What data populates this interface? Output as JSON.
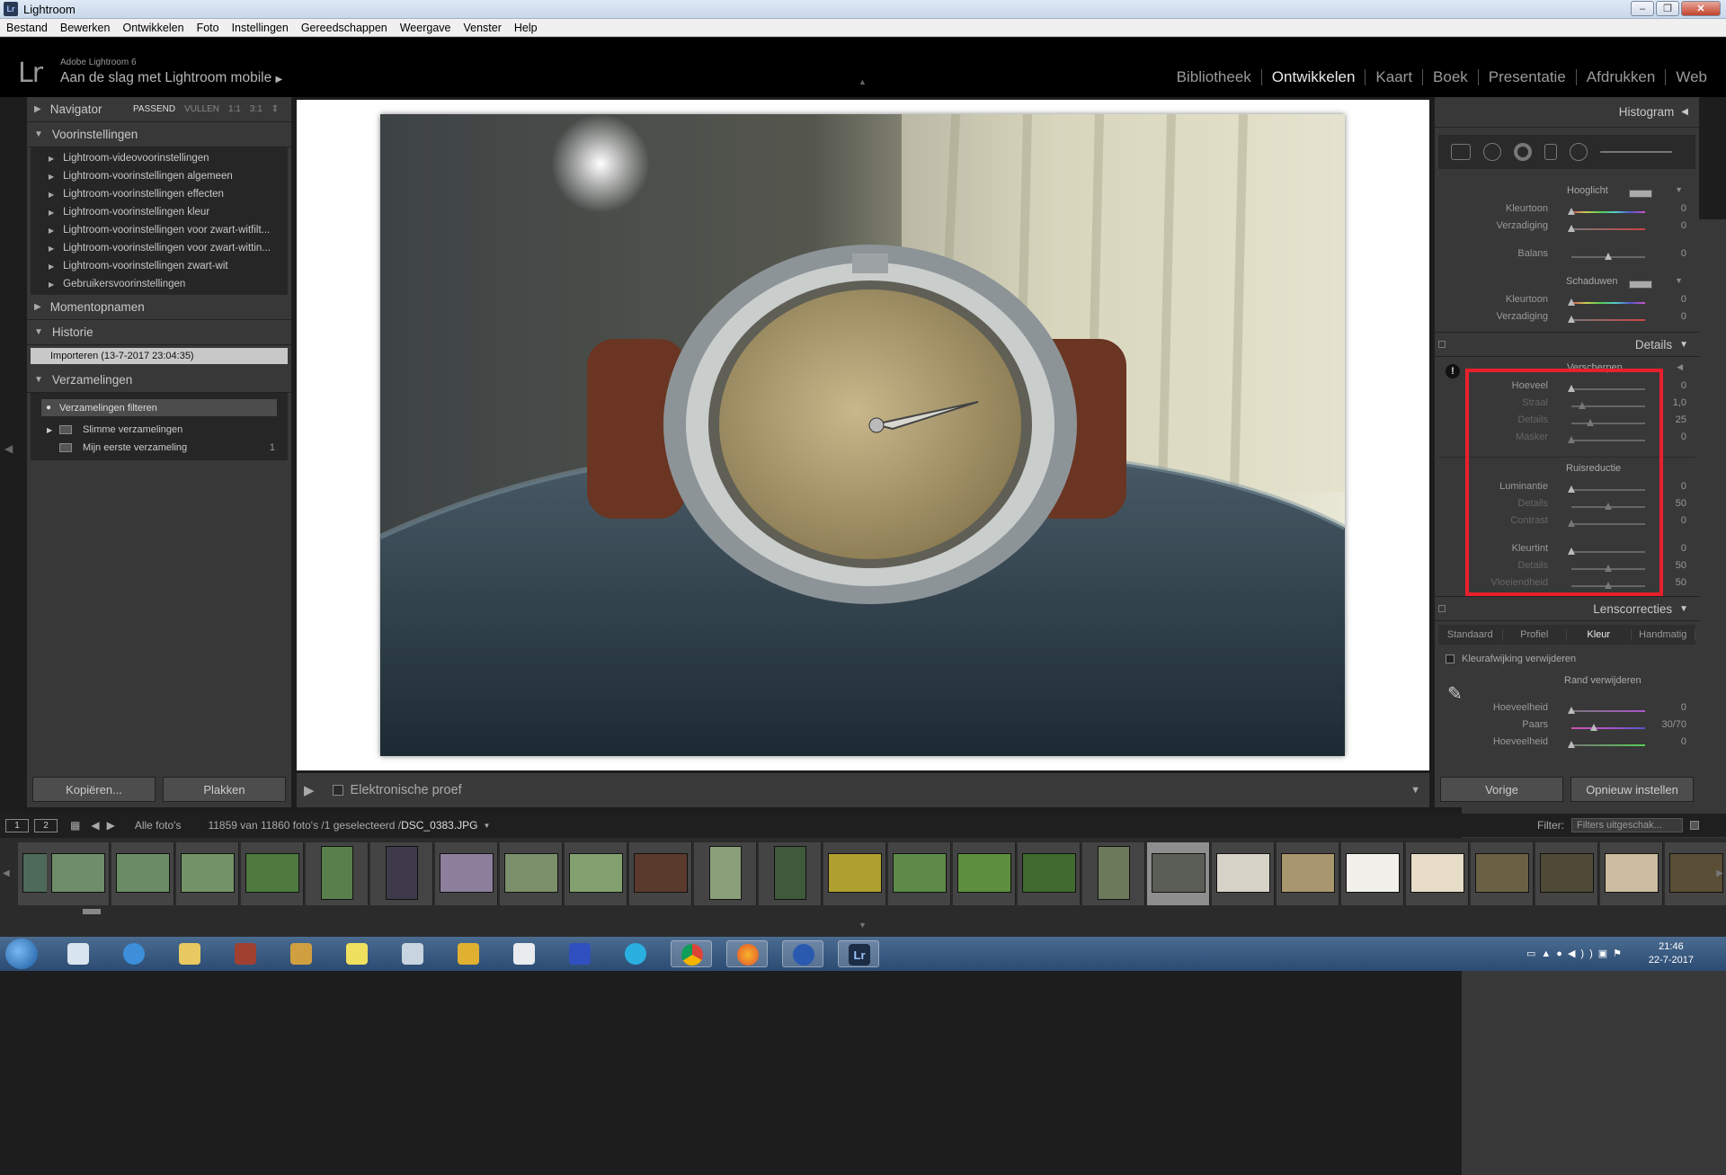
{
  "window": {
    "title": "Lightroom",
    "app_icon_text": "Lr",
    "buttons": {
      "minimize": "–",
      "maximize": "❐",
      "close": "✕"
    }
  },
  "menu": [
    "Bestand",
    "Bewerken",
    "Ontwikkelen",
    "Foto",
    "Instellingen",
    "Gereedschappen",
    "Weergave",
    "Venster",
    "Help"
  ],
  "identity": {
    "logo": "Lr",
    "product": "Adobe Lightroom 6",
    "title": "Aan de slag met Lightroom mobile",
    "play": "▶"
  },
  "modules": {
    "items": [
      "Bibliotheek",
      "Ontwikkelen",
      "Kaart",
      "Boek",
      "Presentatie",
      "Afdrukken",
      "Web"
    ],
    "active": "Ontwikkelen"
  },
  "left": {
    "navigator": {
      "label": "Navigator",
      "opts": [
        "PASSEND",
        "VULLEN",
        "1:1",
        "3:1"
      ],
      "active_opt": "PASSEND",
      "spinner": "⇕"
    },
    "presets": {
      "label": "Voorinstellingen",
      "add": "+",
      "items": [
        "Lightroom-videovoorinstellingen",
        "Lightroom-voorinstellingen algemeen",
        "Lightroom-voorinstellingen effecten",
        "Lightroom-voorinstellingen kleur",
        "Lightroom-voorinstellingen voor zwart-witfilt...",
        "Lightroom-voorinstellingen voor zwart-wittin...",
        "Lightroom-voorinstellingen zwart-wit",
        "Gebruikersvoorinstellingen"
      ]
    },
    "snapshots": {
      "label": "Momentopnamen",
      "add": "+"
    },
    "history": {
      "label": "Historie",
      "clear": "✕",
      "item": "Importeren  (13-7-2017 23:04:35)"
    },
    "collections": {
      "label": "Verzamelingen",
      "add": "+",
      "filter": "Verzamelingen filteren",
      "items": [
        {
          "name": "Slimme verzamelingen",
          "count": ""
        },
        {
          "name": "Mijn eerste verzameling",
          "count": "1"
        }
      ]
    },
    "copy_button": "Kopiëren...",
    "paste_button": "Plakken"
  },
  "toolbar": {
    "play": "▶",
    "soft_proof": "Elektronische proef",
    "menu": "▼"
  },
  "right": {
    "histogram": "Histogram",
    "split_toning": {
      "highlights": "Hooglicht",
      "shadows": "Schaduwen",
      "rows_hi": [
        {
          "label": "Kleurtoon",
          "value": "0",
          "pos": 0
        },
        {
          "label": "Verzadiging",
          "value": "0",
          "pos": 0
        }
      ],
      "balance": {
        "label": "Balans",
        "value": "0",
        "pos": 0.5
      },
      "rows_sh": [
        {
          "label": "Kleurtoon",
          "value": "0",
          "pos": 0
        },
        {
          "label": "Verzadiging",
          "value": "0",
          "pos": 0
        }
      ]
    },
    "details": {
      "label": "Details",
      "warning": "!",
      "sharpen_title": "Verscherpen",
      "sharpen": [
        {
          "label": "Hoeveel",
          "value": "0",
          "pos": 0,
          "dim": false
        },
        {
          "label": "Straal",
          "value": "1,0",
          "pos": 0.15,
          "dim": true
        },
        {
          "label": "Details",
          "value": "25",
          "pos": 0.25,
          "dim": true
        },
        {
          "label": "Masker",
          "value": "0",
          "pos": 0,
          "dim": true
        }
      ],
      "noise_title": "Ruisreductie",
      "noise": [
        {
          "label": "Luminantie",
          "value": "0",
          "pos": 0,
          "dim": false
        },
        {
          "label": "Details",
          "value": "50",
          "pos": 0.5,
          "dim": true
        },
        {
          "label": "Contrast",
          "value": "0",
          "pos": 0,
          "dim": true
        }
      ],
      "color": [
        {
          "label": "Kleurtint",
          "value": "0",
          "pos": 0,
          "dim": false
        },
        {
          "label": "Details",
          "value": "50",
          "pos": 0.5,
          "dim": true
        },
        {
          "label": "Vloeiendheid",
          "value": "50",
          "pos": 0.5,
          "dim": true
        }
      ]
    },
    "lens": {
      "label": "Lenscorrecties",
      "tabs": [
        "Standaard",
        "Profiel",
        "Kleur",
        "Handmatig"
      ],
      "active_tab": "Kleur",
      "remove_ca": "Kleurafwijking verwijderen",
      "defringe": "Rand verwijderen",
      "rows": [
        {
          "label": "Hoeveelheid",
          "value": "0",
          "pos": 0
        },
        {
          "label": "Paars",
          "value": "30/70",
          "pos": 0.3
        },
        {
          "label": "Hoeveelheid",
          "value": "0",
          "pos": 0
        }
      ]
    },
    "prev_button": "Vorige",
    "reset_button": "Opnieuw instellen"
  },
  "filmstrip": {
    "pages": [
      "1",
      "2"
    ],
    "source": "Alle foto's",
    "count": "11859 van 11860 foto's /1 geselecteerd /",
    "filename": "DSC_0383.JPG",
    "filter_label": "Filter:",
    "filter_value": "Filters uitgeschak..."
  },
  "taskbar": {
    "time": "21:46",
    "date": "22-7-2017",
    "lr_label": "Lr"
  }
}
